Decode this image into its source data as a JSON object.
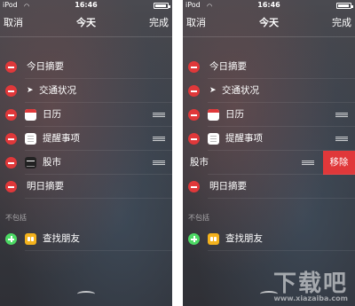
{
  "status": {
    "carrier": "iPod",
    "wifi_icon": "wifi-icon",
    "time": "16:46"
  },
  "nav": {
    "cancel": "取消",
    "title": "今天",
    "done": "完成"
  },
  "items": [
    {
      "label": "今日摘要",
      "icon": "none"
    },
    {
      "label": "交通状况",
      "icon": "location-arrow-icon"
    },
    {
      "label": "日历",
      "icon": "calendar-icon"
    },
    {
      "label": "提醒事项",
      "icon": "reminders-icon"
    },
    {
      "label": "股市",
      "icon": "stocks-icon"
    },
    {
      "label": "明日摘要",
      "icon": "none"
    }
  ],
  "excluded_section": {
    "title": "不包括",
    "items": [
      {
        "label": "查找朋友",
        "icon": "find-friends-icon"
      }
    ]
  },
  "swipe_action": {
    "label": "移除"
  },
  "watermark": {
    "main": "下载吧",
    "sub": "www.xiazaiba.com"
  }
}
